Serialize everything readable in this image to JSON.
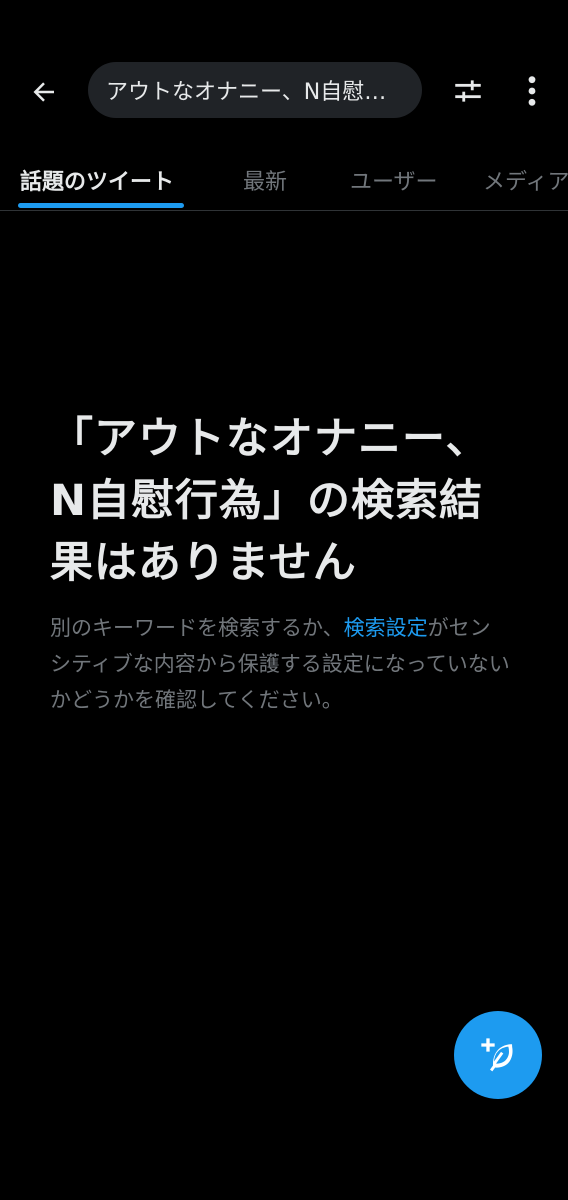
{
  "header": {
    "search_query": "アウトなオナニー、N自慰行為",
    "back_icon": "arrow-left-icon",
    "filter_icon": "sliders-icon",
    "more_icon": "more-vertical-icon"
  },
  "tabs": [
    {
      "label": "話題のツイート",
      "active": true
    },
    {
      "label": "最新",
      "active": false
    },
    {
      "label": "ユーザー",
      "active": false
    },
    {
      "label": "メディア",
      "active": false
    }
  ],
  "empty_state": {
    "title": "「アウトなオナニー、N自慰行為」の検索結果はありません",
    "desc_before": "別のキーワードを検索するか、",
    "desc_link": "検索設定",
    "desc_after": "がセンシティブな内容から保護する設定になっていないかどうかを確認してください。"
  },
  "fab": {
    "icon": "compose-tweet-icon"
  },
  "colors": {
    "background": "#000000",
    "accent": "#1d9bf0",
    "text_primary": "#e7e9ea",
    "text_secondary": "#71767b",
    "search_bg": "#202327",
    "divider": "#2f3336"
  }
}
